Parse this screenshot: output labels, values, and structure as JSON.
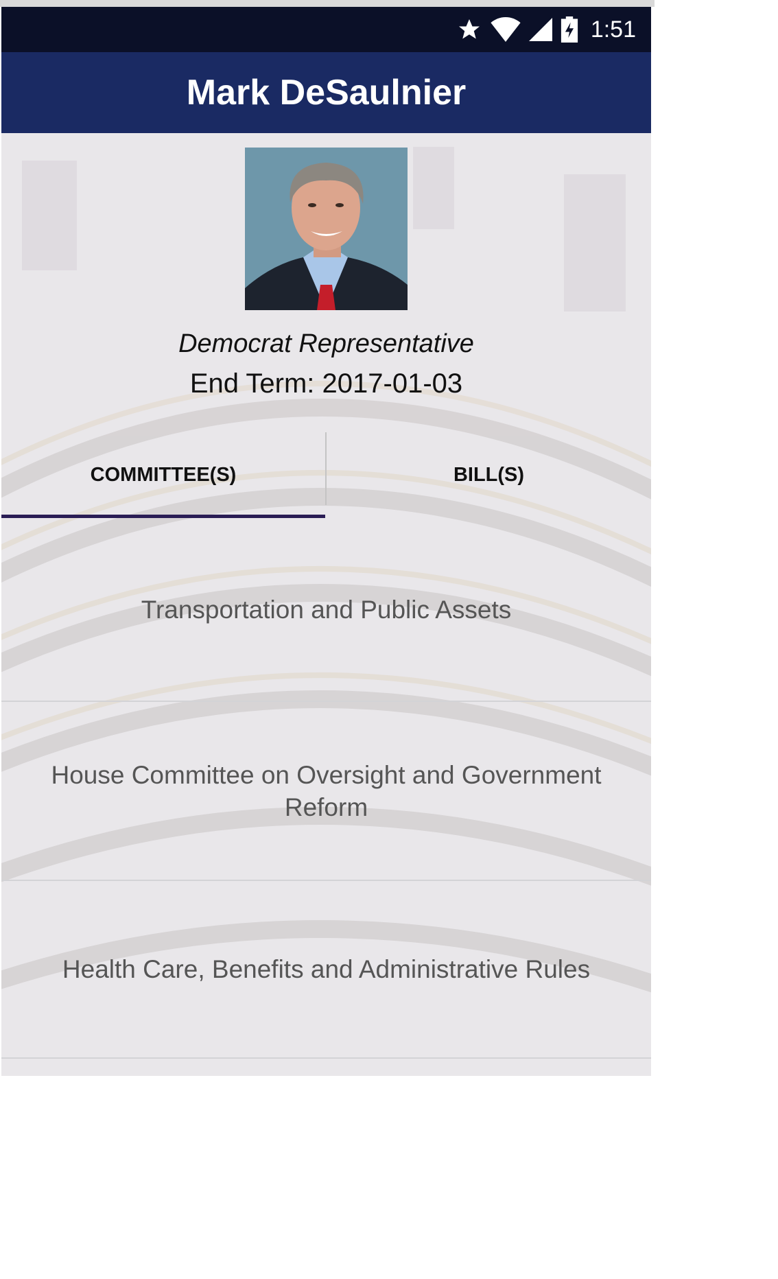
{
  "status_bar": {
    "time": "1:51",
    "icons": [
      "star-icon",
      "wifi-icon",
      "cell-signal-icon",
      "battery-charging-icon"
    ]
  },
  "app_bar": {
    "title": "Mark DeSaulnier"
  },
  "profile": {
    "photo": "legislator-portrait",
    "party_chamber": "Democrat Representative",
    "end_term_label": "End Term:",
    "end_term_value": "2017-01-03"
  },
  "tabs": [
    {
      "label": "COMMITTEE(S)",
      "selected": true
    },
    {
      "label": "BILL(S)",
      "selected": false
    }
  ],
  "committees": [
    {
      "name": "Transportation and Public Assets"
    },
    {
      "name": "House Committee on Oversight and Government Reform"
    },
    {
      "name": "Health Care, Benefits and Administrative Rules"
    }
  ],
  "colors": {
    "status_bar": "#0b1028",
    "app_bar": "#1a2a63",
    "tab_indicator": "#2a1d55",
    "list_text": "#555555"
  }
}
